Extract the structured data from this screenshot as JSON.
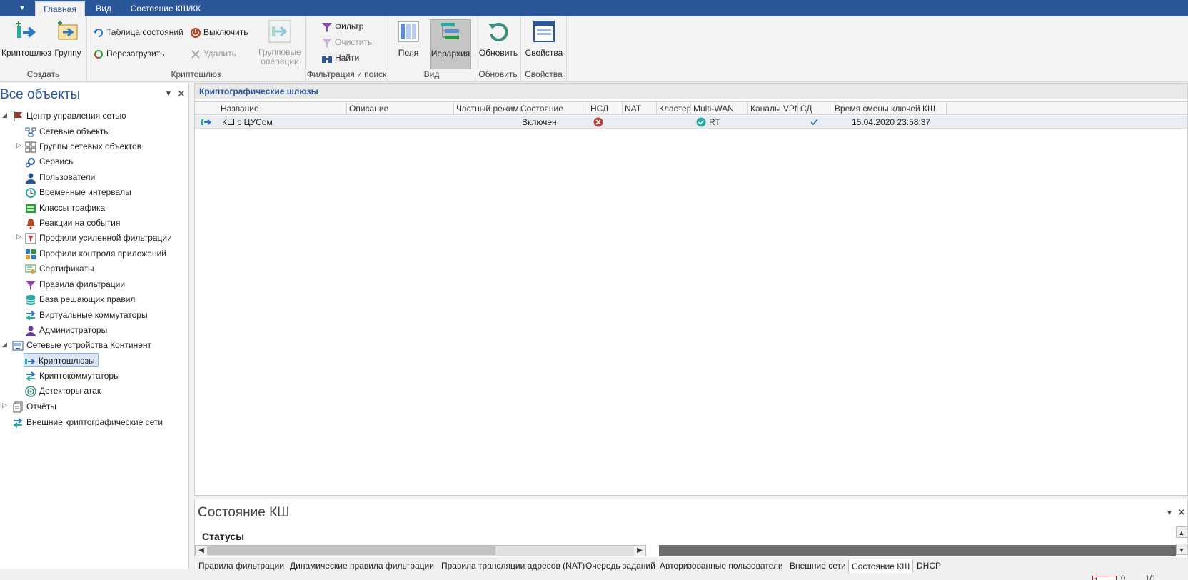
{
  "ribbon_tabs": [
    {
      "label": "Главная",
      "active": true
    },
    {
      "label": "Вид",
      "active": false
    },
    {
      "label": "Состояние КШ/КК",
      "active": false
    }
  ],
  "ribbon": {
    "create": {
      "label": "Создать",
      "cryptogateway_label": "Криптошлюз",
      "group_label": "Группу"
    },
    "cryptogateway": {
      "label": "Криптошлюз",
      "state_table": "Таблица состояний",
      "reboot": "Перезагрузить",
      "power_off": "Выключить",
      "delete": "Удалить",
      "group_ops_line1": "Групповые",
      "group_ops_line2": "операции"
    },
    "filter": {
      "label": "Фильтрация и поиск",
      "filter": "Фильтр",
      "clear": "Очистить",
      "find": "Найти"
    },
    "view": {
      "label": "Вид",
      "fields": "Поля",
      "hierarchy": "Иерархия"
    },
    "refresh": {
      "label": "Обновить",
      "refresh": "Обновить"
    },
    "properties": {
      "label": "Свойства",
      "properties": "Свойства"
    }
  },
  "left_panel": {
    "title": "Все объекты",
    "tree": [
      {
        "label": "Центр управления сетью",
        "level": 0,
        "expanded": true,
        "icon": "flag-icon"
      },
      {
        "label": "Сетевые объекты",
        "level": 1,
        "icon": "network-objects-icon"
      },
      {
        "label": "Группы сетевых объектов",
        "level": 1,
        "collapsed": true,
        "icon": "network-groups-icon"
      },
      {
        "label": "Сервисы",
        "level": 1,
        "icon": "services-gear-icon"
      },
      {
        "label": "Пользователи",
        "level": 1,
        "icon": "user-icon"
      },
      {
        "label": "Временные интервалы",
        "level": 1,
        "icon": "clock-icon"
      },
      {
        "label": "Классы трафика",
        "level": 1,
        "icon": "traffic-class-icon"
      },
      {
        "label": "Реакции на события",
        "level": 1,
        "icon": "bell-icon"
      },
      {
        "label": "Профили усиленной фильтрации",
        "level": 1,
        "collapsed": true,
        "icon": "filter-profile-icon"
      },
      {
        "label": "Профили контроля приложений",
        "level": 1,
        "icon": "app-control-icon"
      },
      {
        "label": "Сертификаты",
        "level": 1,
        "icon": "certificate-icon"
      },
      {
        "label": "Правила фильтрации",
        "level": 1,
        "icon": "filter-rules-icon"
      },
      {
        "label": "База решающих правил",
        "level": 1,
        "icon": "database-icon"
      },
      {
        "label": "Виртуальные коммутаторы",
        "level": 1,
        "icon": "virtual-switch-icon"
      },
      {
        "label": "Администраторы",
        "level": 1,
        "icon": "admin-icon"
      },
      {
        "label": "Сетевые устройства Континент",
        "level": 0,
        "expanded": true,
        "icon": "device-icon"
      },
      {
        "label": "Криптошлюзы",
        "level": 1,
        "selected": true,
        "icon": "cryptogateway-icon"
      },
      {
        "label": "Криптокоммутаторы",
        "level": 1,
        "icon": "cryptoswitch-icon"
      },
      {
        "label": "Детекторы атак",
        "level": 1,
        "icon": "attack-detector-icon"
      },
      {
        "label": "Отчёты",
        "level": 0,
        "collapsed": true,
        "icon": "reports-icon"
      },
      {
        "label": "Внешние криптографические сети",
        "level": 0,
        "icon": "external-network-icon"
      }
    ]
  },
  "main": {
    "title": "Криптографические шлюзы",
    "columns": [
      "Название",
      "Описание",
      "Частный режим",
      "Состояние",
      "НСД",
      "NAT",
      "Кластер",
      "Multi-WAN",
      "Каналы VPN",
      "СД",
      "Время смены ключей КШ"
    ],
    "rows": [
      {
        "name": "КШ с ЦУСом",
        "description": "",
        "private_mode": "",
        "state": "Включен",
        "nsd": "error",
        "nat": "",
        "cluster": "",
        "multiwan": "RT",
        "vpn": "",
        "sd": "check",
        "key_change_time": "15.04.2020 23:58:37"
      }
    ]
  },
  "bottom_pane": {
    "title": "Состояние КШ",
    "section": "Статусы"
  },
  "bottom_tabs": [
    {
      "label": "Правила фильтрации",
      "active": false
    },
    {
      "label": "Динамические правила фильтрации",
      "active": false
    },
    {
      "label": "Правила трансляции адресов (NAT)",
      "active": false
    },
    {
      "label": "Очередь заданий",
      "active": false
    },
    {
      "label": "Авторизованные пользователи",
      "active": false
    },
    {
      "label": "Внешние сети",
      "active": false
    },
    {
      "label": "Состояние КШ",
      "active": true
    },
    {
      "label": "DHCP",
      "active": false
    }
  ],
  "pager": {
    "page_value": "1",
    "of_text": "0",
    "count_text": "1/1"
  },
  "colors": {
    "accent": "#2b579a",
    "error": "#c0392b",
    "ok": "#2aa9a0"
  }
}
